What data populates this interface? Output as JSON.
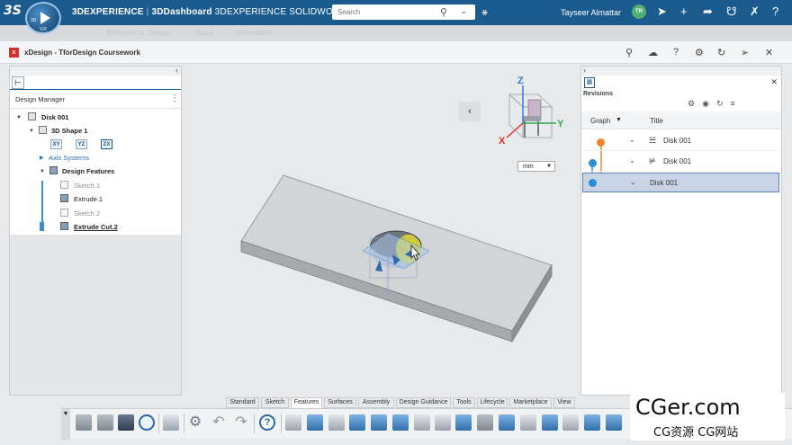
{
  "topbar": {
    "brand": "3DEXPERIENCE",
    "dashboard": "3DDashboard",
    "app": "3DEXPERIENCE SOLIDWORKS",
    "search_placeholder": "Search",
    "username": "Tayseer Almattar",
    "avatar_initials": "TR",
    "compass_label_3d": "3D",
    "compass_label_vr": "V,R",
    "logo_glyph": "3S",
    "colors": {
      "bar": "#1b5a8c",
      "avatar": "#4faf6f"
    }
  },
  "tabrow": {
    "items": [
      "Welcome to ...",
      "Design",
      "Share",
      "Information",
      "+"
    ]
  },
  "appbar": {
    "title": "xDesign - TforDesign Coursework",
    "icon_letter": "x"
  },
  "design_manager": {
    "title": "Design Manager",
    "root": "Disk 001",
    "shape": "3D Shape 1",
    "planes": [
      "XY",
      "YZ",
      "ZX"
    ],
    "axis_systems": "Axis Systems",
    "design_features": "Design Features",
    "features": [
      {
        "label": "Sketch.1",
        "state": "gray"
      },
      {
        "label": "Extrude.1",
        "state": "normal"
      },
      {
        "label": "Sketch.2",
        "state": "gray"
      },
      {
        "label": "Extrude Cut.2",
        "state": "active"
      }
    ]
  },
  "viewport": {
    "units": "mm",
    "axis_labels": {
      "x": "X",
      "y": "Y",
      "z": "Z"
    },
    "colors": {
      "x_axis": "#e0302a",
      "y_axis": "#2ea84a",
      "z_axis": "#2f7fd8",
      "hole_highlight": "#e8e21c"
    }
  },
  "revisions": {
    "title": "Revisions",
    "col_graph": "Graph",
    "col_title": "Title",
    "rows": [
      {
        "title": "Disk 001",
        "dot_color": "#f0852d",
        "selected": false
      },
      {
        "title": "Disk 001",
        "dot_color": "#2a8fd4",
        "selected": false
      },
      {
        "title": "Disk 001",
        "dot_color": "#2a8fd4",
        "selected": true
      }
    ]
  },
  "action_bar": {
    "tabs": [
      "Standard",
      "Sketch",
      "Features",
      "Surfaces",
      "Assembly",
      "Design Guidance",
      "Tools",
      "Lifecycle",
      "Marketplace",
      "View"
    ],
    "active_tab": "Features"
  },
  "watermark": {
    "main": "CGer.com",
    "sub": "CG资源 CG网站"
  }
}
